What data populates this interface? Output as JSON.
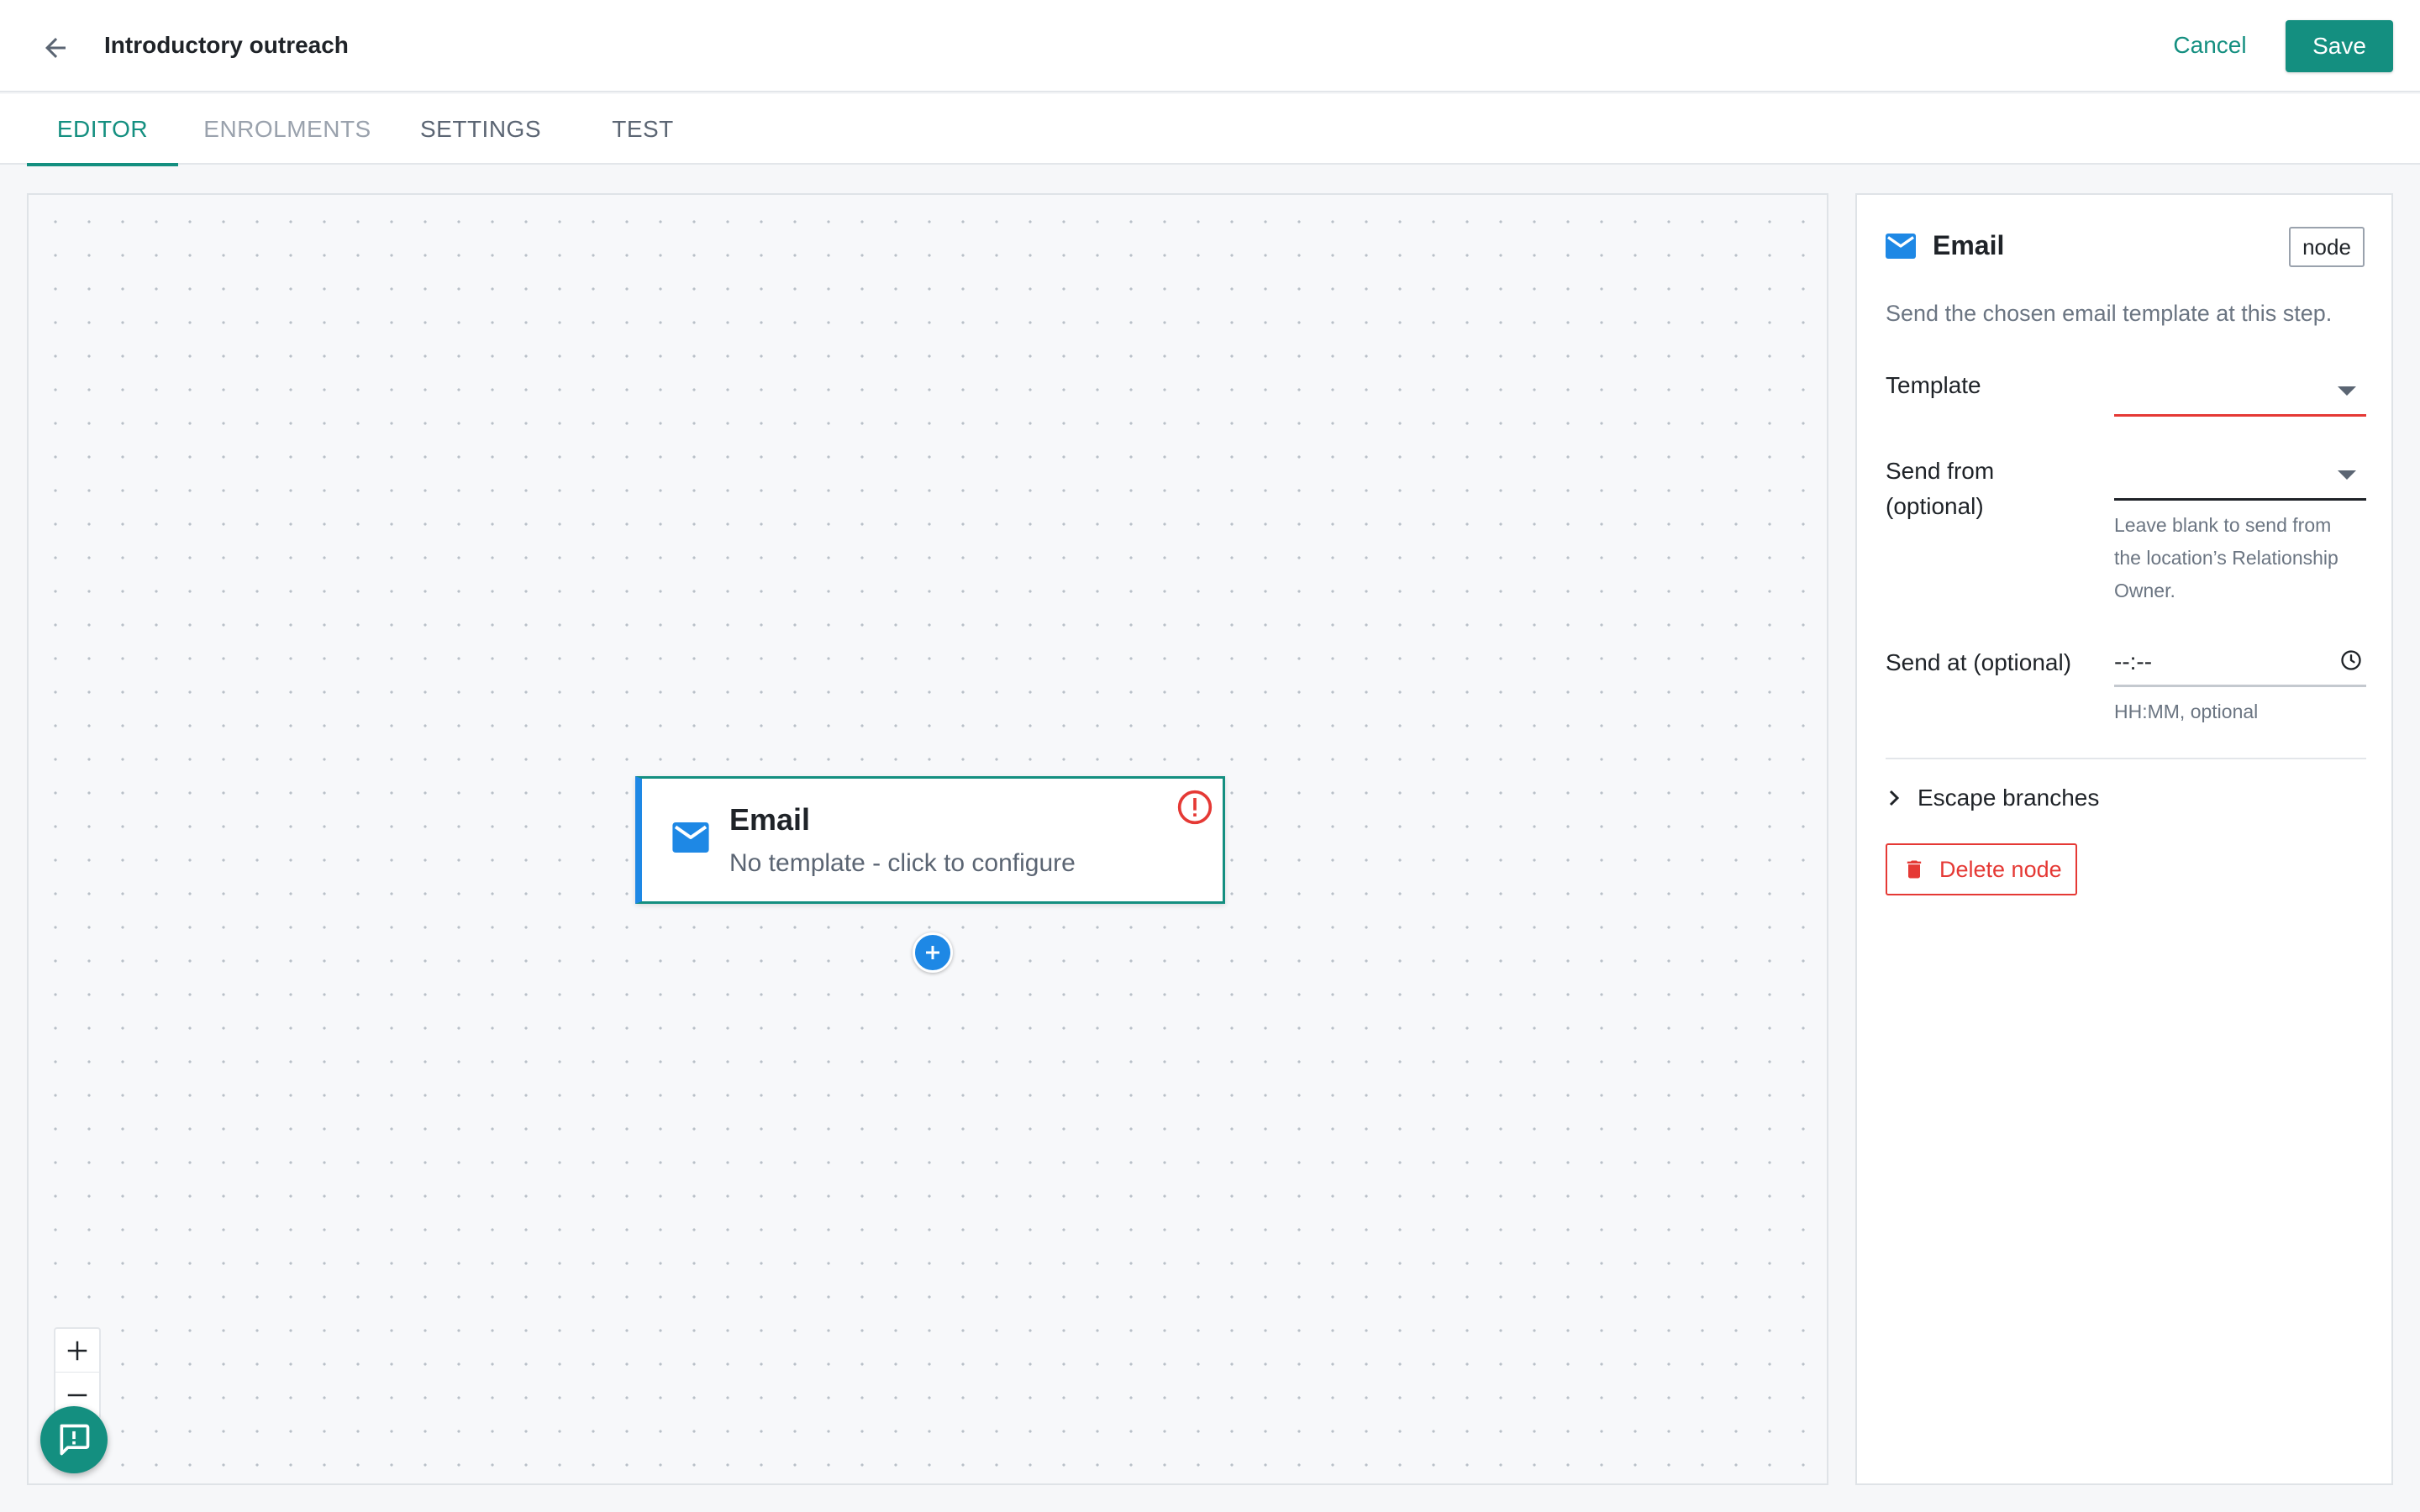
{
  "header": {
    "title": "Introductory outreach",
    "cancel_label": "Cancel",
    "save_label": "Save"
  },
  "tabs": [
    {
      "label": "EDITOR",
      "state": "active"
    },
    {
      "label": "ENROLMENTS",
      "state": "muted"
    },
    {
      "label": "SETTINGS",
      "state": "normal"
    },
    {
      "label": "TEST",
      "state": "normal"
    }
  ],
  "canvas": {
    "node": {
      "icon": "mail-icon",
      "title": "Email",
      "subtitle": "No template - click to configure",
      "status_icon": "alert-circle-icon"
    },
    "add_button_icon": "plus-icon",
    "zoom": {
      "in_icon": "plus-icon",
      "out_icon": "minus-icon"
    },
    "feedback_icon": "feedback-icon"
  },
  "panel": {
    "icon": "mail-icon",
    "title": "Email",
    "badge": "node",
    "description": "Send the chosen email template at this step.",
    "template": {
      "label": "Template",
      "value": "",
      "state": "error"
    },
    "send_from": {
      "label_line1": "Send from",
      "label_line2": "(optional)",
      "value": "",
      "helper_line1": "Leave blank to send from",
      "helper_line2": "the location’s Relationship",
      "helper_line3": "Owner."
    },
    "send_at": {
      "label": "Send at (optional)",
      "value": "--:--",
      "helper": "HH:MM, optional"
    },
    "escape_branches_label": "Escape branches",
    "delete_label": "Delete node"
  },
  "colors": {
    "accent": "#148f80",
    "node_blue": "#1e88e5",
    "error": "#e53935"
  }
}
